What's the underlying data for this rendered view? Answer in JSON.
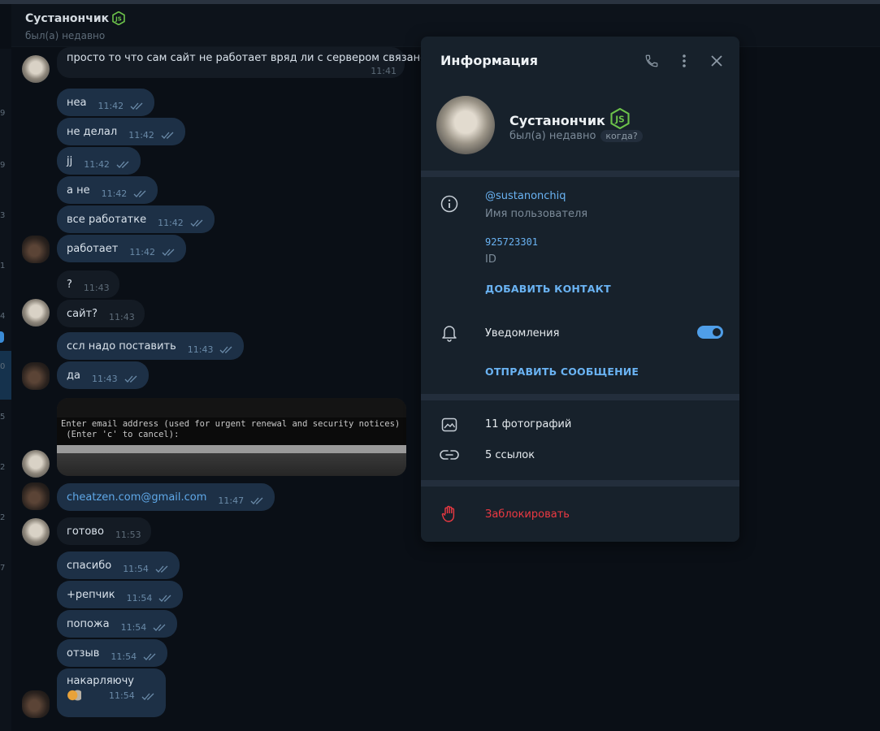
{
  "chat": {
    "name": "Сустанончик",
    "status": "был(а) недавно"
  },
  "left_list_digits": [
    "9",
    "9",
    "3",
    "1",
    "4",
    "0",
    "5",
    "2",
    "2",
    "7"
  ],
  "messages": [
    {
      "text": "просто то что сам сайт не работает вряд ли с сервером связано",
      "time": "11:41",
      "dir": "in"
    },
    {
      "text": "неа",
      "time": "11:42",
      "dir": "out"
    },
    {
      "text": "не делал",
      "time": "11:42",
      "dir": "out"
    },
    {
      "text": "jj",
      "time": "11:42",
      "dir": "out"
    },
    {
      "text": "а не",
      "time": "11:42",
      "dir": "out"
    },
    {
      "text": "все работатке",
      "time": "11:42",
      "dir": "out"
    },
    {
      "text": "работает",
      "time": "11:42",
      "dir": "out"
    },
    {
      "text": "?",
      "time": "11:43",
      "dir": "in"
    },
    {
      "text": "сайт?",
      "time": "11:43",
      "dir": "in"
    },
    {
      "text": "ссл надо поставить",
      "time": "11:43",
      "dir": "out"
    },
    {
      "text": "да",
      "time": "11:43",
      "dir": "out"
    },
    {
      "text": "cheatzen.com@gmail.com",
      "time": "11:47",
      "dir": "out"
    },
    {
      "text": "готово",
      "time": "11:53",
      "dir": "in"
    },
    {
      "text": "спасибо",
      "time": "11:54",
      "dir": "out"
    },
    {
      "text": "+репчик",
      "time": "11:54",
      "dir": "out"
    },
    {
      "text": "попожа",
      "time": "11:54",
      "dir": "out"
    },
    {
      "text": "отзыв",
      "time": "11:54",
      "dir": "out"
    },
    {
      "text": "накарляючу",
      "time": "11:54",
      "dir": "out"
    }
  ],
  "screenshot_terminal": {
    "line1": "Enter email address (used for urgent renewal and security notices)",
    "line2": " (Enter 'c' to cancel):"
  },
  "panel": {
    "title": "Информация",
    "name": "Сустанончик",
    "status": "был(а) недавно",
    "when_badge": "когда?",
    "username": "@sustanonchiq",
    "username_label": "Имя пользователя",
    "id_value": "925723301",
    "id_label": "ID",
    "add_contact": "ДОБАВИТЬ КОНТАКТ",
    "notifications": "Уведомления",
    "notifications_on": true,
    "send_message": "ОТПРАВИТЬ СООБЩЕНИЕ",
    "photos": "11 фотографий",
    "links": "5 ссылок",
    "block": "Заблокировать"
  },
  "colors": {
    "accent": "#6ab3f3",
    "danger": "#ec3942",
    "js_green": "#6cc24a"
  }
}
